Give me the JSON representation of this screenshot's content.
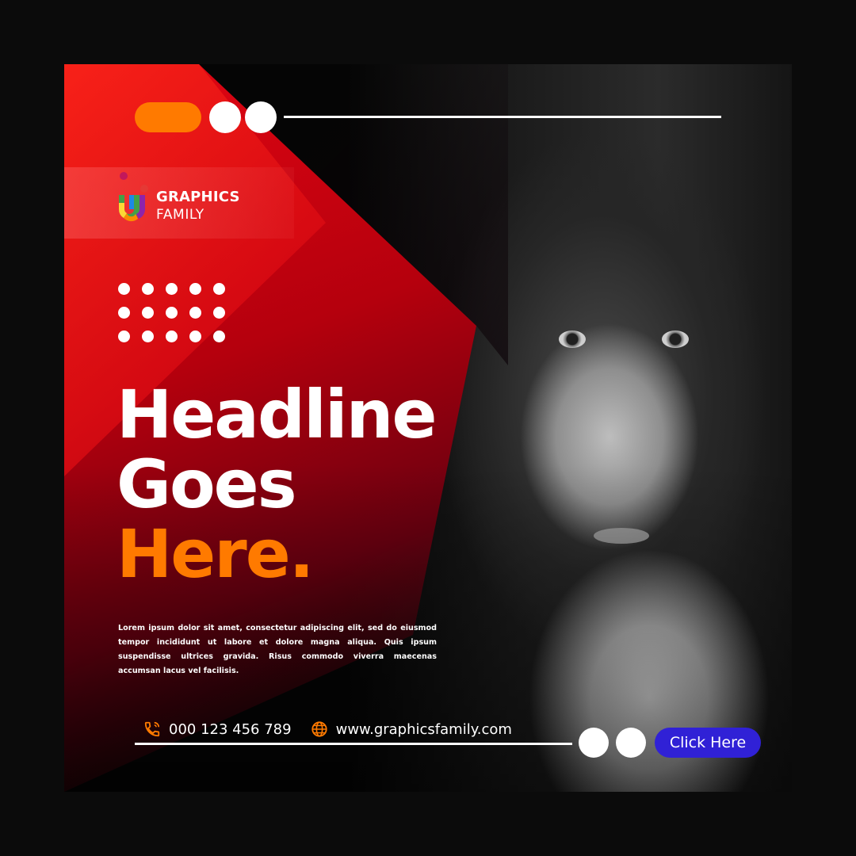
{
  "brand": {
    "name_line1": "GRAPHICS",
    "name_line2": "FAMILY"
  },
  "headline": {
    "line1": "Headline",
    "line2": "Goes",
    "line3": "Here",
    "line3_suffix": "."
  },
  "body": {
    "text": "Lorem ipsum dolor sit amet, consectetur adipiscing elit, sed do eiusmod tempor incididunt ut labore et dolore magna aliqua. Quis ipsum suspendisse ultrices gravida. Risus commodo viverra maecenas accumsan lacus vel facilisis."
  },
  "contact": {
    "phone": "000 123 456 789",
    "website": "www.graphicsfamily.com",
    "phone_icon": "phone-icon",
    "web_icon": "globe-icon"
  },
  "cta": {
    "label": "Click Here"
  },
  "colors": {
    "accent_orange": "#ff7a00",
    "accent_red": "#e30613",
    "cta_blue": "#3021d6"
  }
}
